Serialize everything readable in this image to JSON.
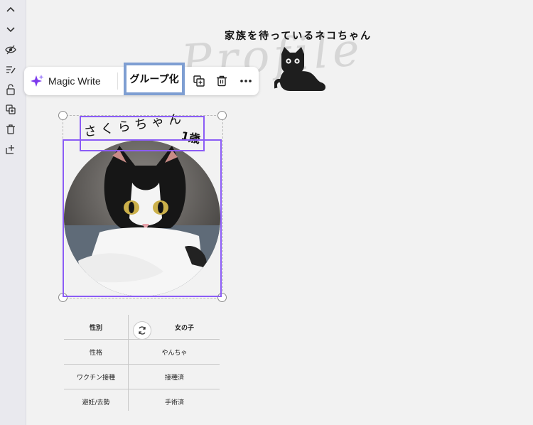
{
  "sidebar": {
    "icons": [
      "chevron-up-icon",
      "chevron-down-icon",
      "eye-icon",
      "edit-lines-icon",
      "unlock-icon",
      "duplicate-icon",
      "trash-icon",
      "export-icon"
    ]
  },
  "design": {
    "title": "家族を待っているネコちゃん",
    "deco_text": "Profile",
    "pet_name": "さくらちゃん",
    "pet_age": "1歳"
  },
  "toolbar": {
    "magic_write_label": "Magic Write",
    "group_label": "グループ化"
  },
  "profile_table": {
    "rows": [
      {
        "label": "性別",
        "value": "女の子"
      },
      {
        "label": "性格",
        "value": "やんちゃ"
      },
      {
        "label": "ワクチン接種",
        "value": "接種済"
      },
      {
        "label": "避妊/去勢",
        "value": "手術済"
      }
    ]
  },
  "colors": {
    "selection": "#8b5cf6",
    "group_highlight": "#7e9ed2",
    "magic_sparkle": "#7c3aed"
  }
}
